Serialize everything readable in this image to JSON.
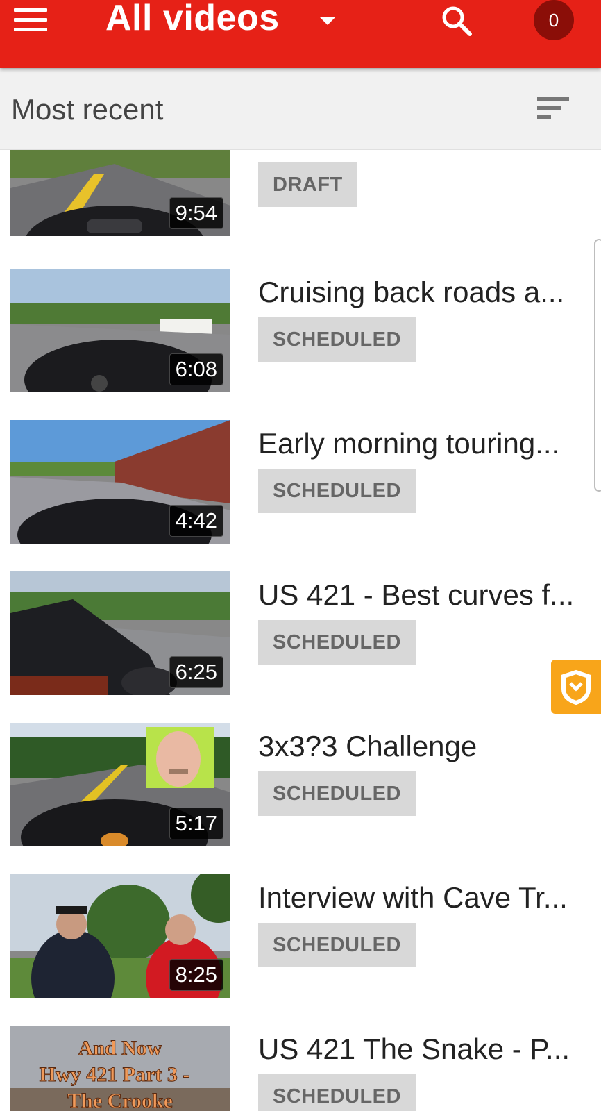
{
  "topbar": {
    "title": "All videos",
    "notification_count": "0",
    "accent_color": "#e62117",
    "icons": [
      "menu-icon",
      "dropdown-caret-icon",
      "search-icon"
    ]
  },
  "sortbar": {
    "label": "Most recent",
    "icon": "sort-icon"
  },
  "videos": [
    {
      "title": "",
      "duration": "9:54",
      "status": "DRAFT"
    },
    {
      "title": "Cruising back roads a...",
      "duration": "6:08",
      "status": "SCHEDULED"
    },
    {
      "title": "Early morning touring...",
      "duration": "4:42",
      "status": "SCHEDULED"
    },
    {
      "title": "US 421 - Best curves f...",
      "duration": "6:25",
      "status": "SCHEDULED"
    },
    {
      "title": "3x3?3 Challenge",
      "duration": "5:17",
      "status": "SCHEDULED"
    },
    {
      "title": "Interview with Cave Tr...",
      "duration": "8:25",
      "status": "SCHEDULED"
    },
    {
      "title": "US 421 The Snake - P...",
      "duration": "",
      "status": "SCHEDULED",
      "thumbnail_text": "And Now Hwy 421 Part 3 - The Crooke"
    }
  ],
  "floating_button": {
    "icon": "shield-icon",
    "color": "#f8a51a"
  }
}
